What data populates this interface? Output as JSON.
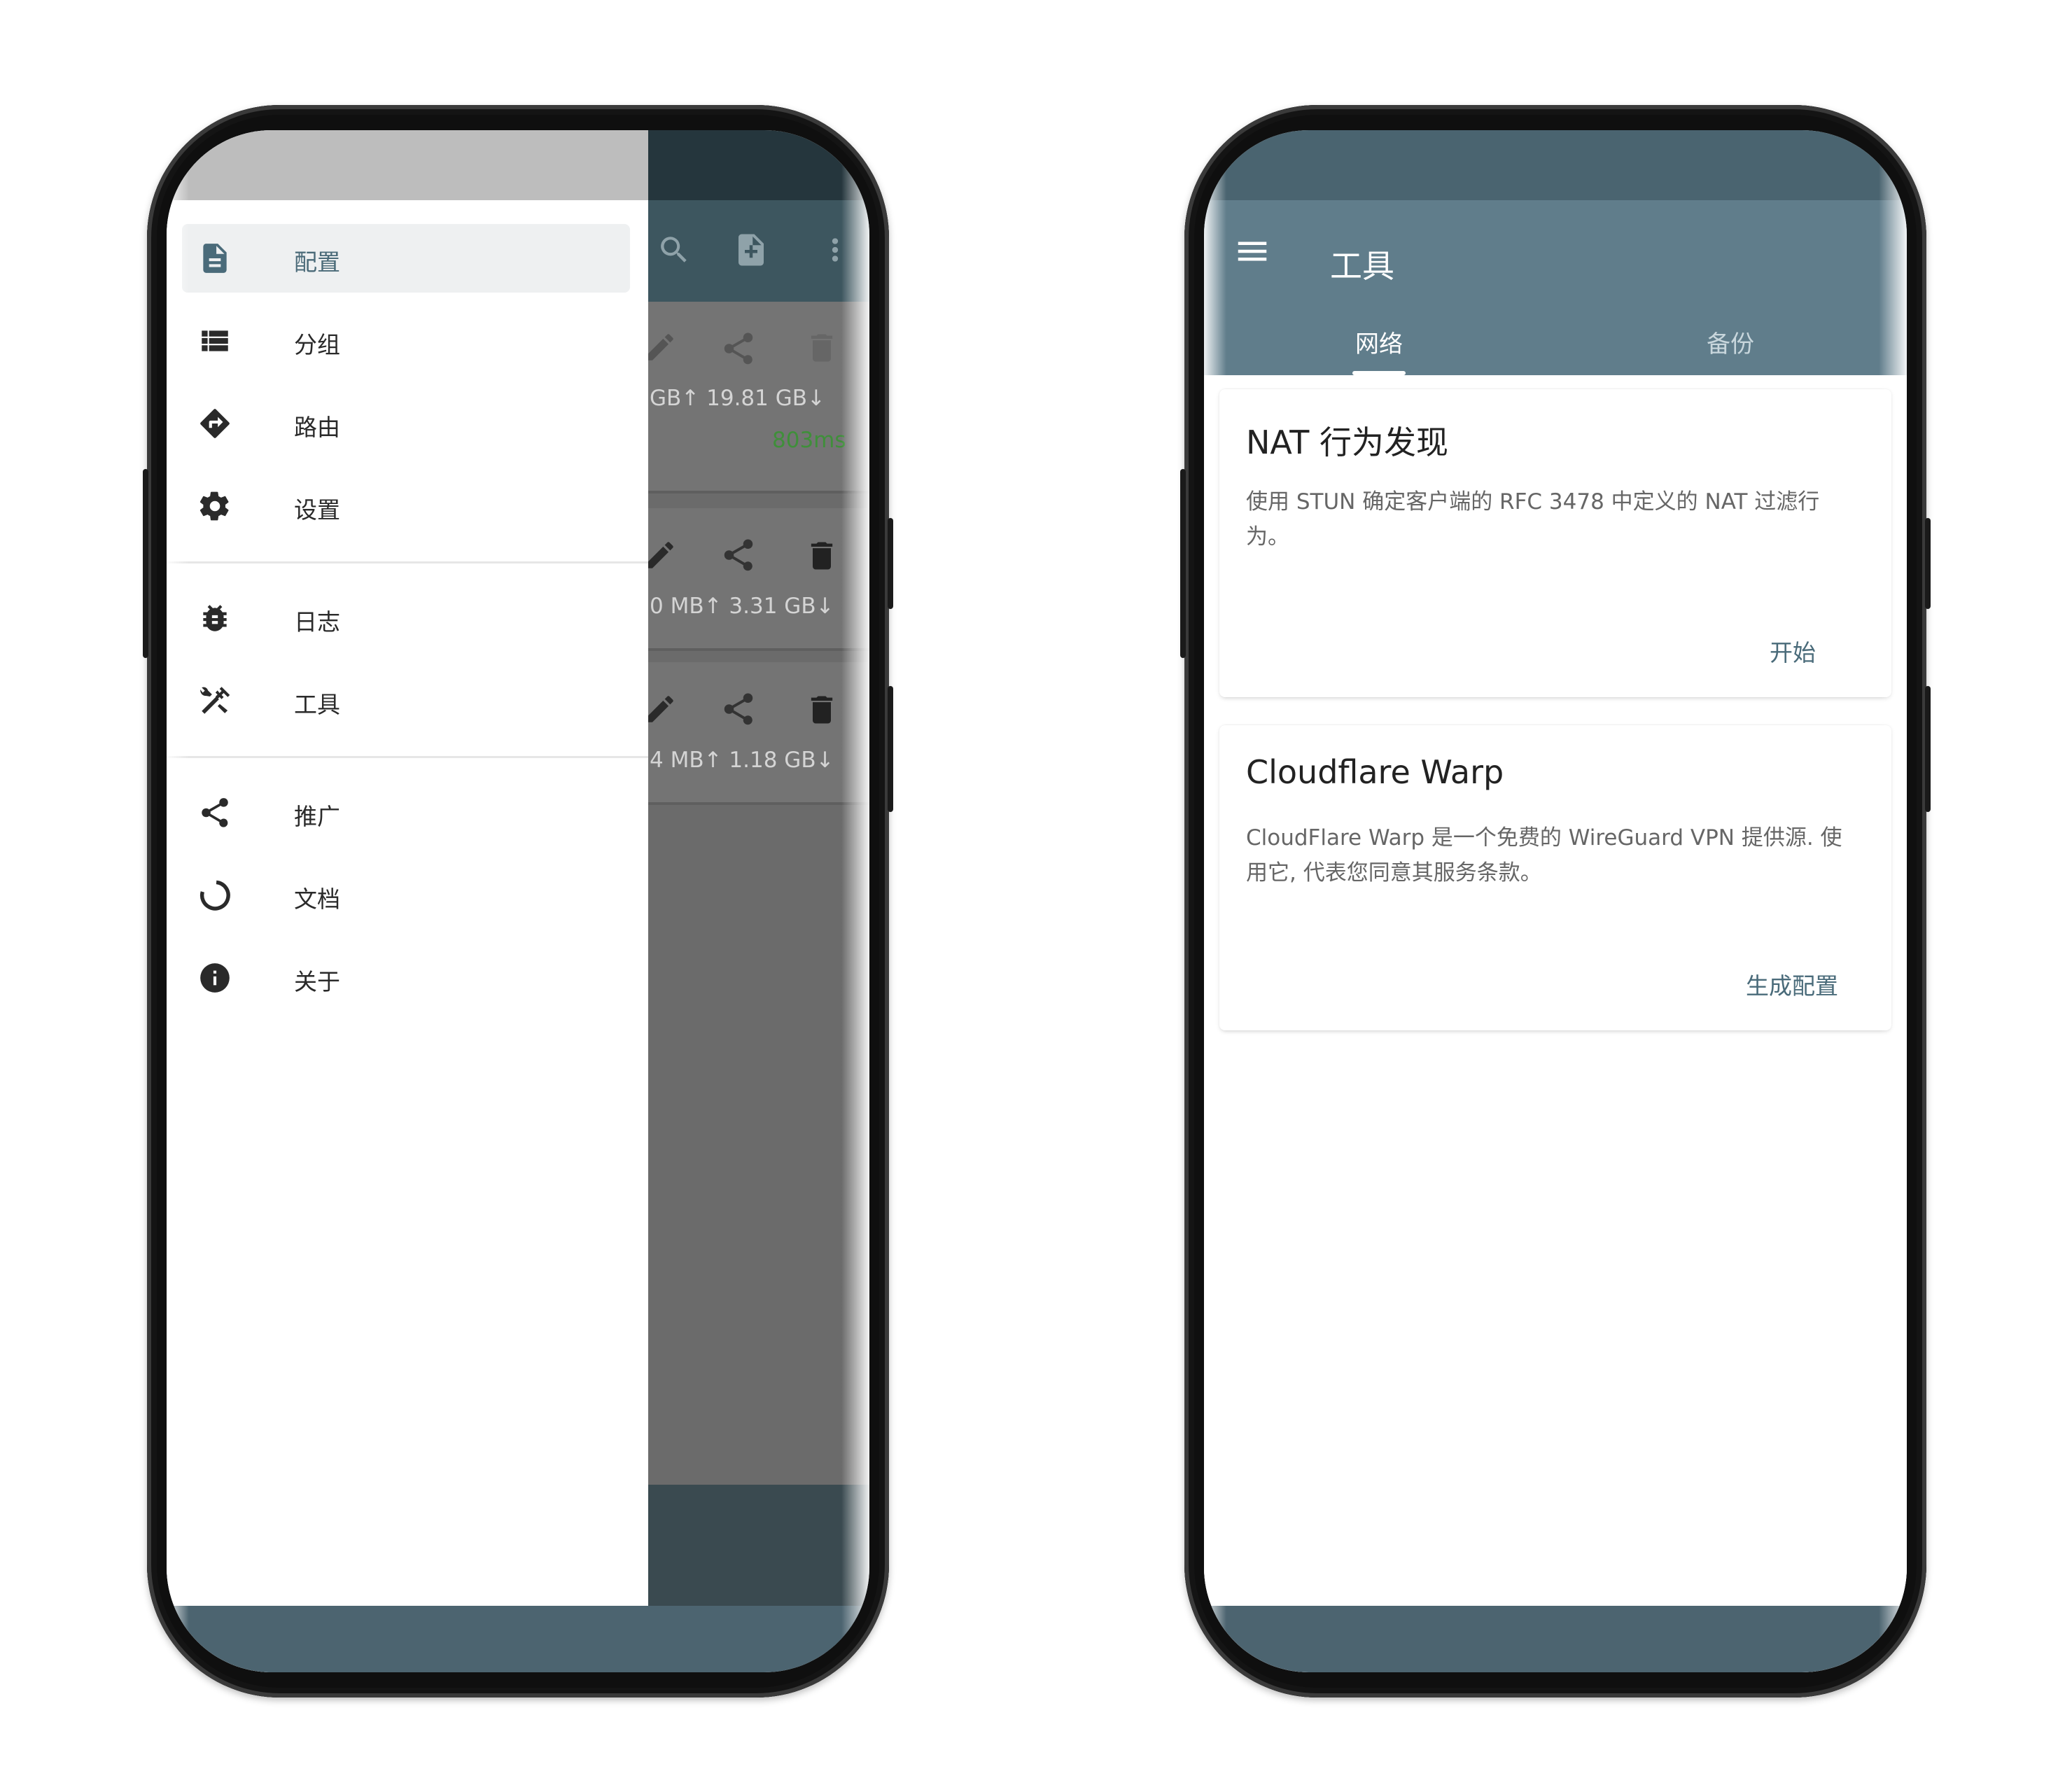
{
  "left_phone": {
    "drawer": {
      "items": [
        {
          "label": "配置",
          "icon": "file-document-icon",
          "active": true
        },
        {
          "label": "分组",
          "icon": "view-list-icon"
        },
        {
          "label": "路由",
          "icon": "directions-icon"
        },
        {
          "label": "设置",
          "icon": "gear-icon"
        },
        {
          "label": "日志",
          "icon": "bug-icon"
        },
        {
          "label": "工具",
          "icon": "tools-icon"
        },
        {
          "label": "推广",
          "icon": "share-icon"
        },
        {
          "label": "文档",
          "icon": "progress-circle-icon"
        },
        {
          "label": "关于",
          "icon": "info-icon"
        }
      ]
    },
    "background_list": {
      "cards": [
        {
          "traffic": "GB↑ 19.81 GB↓",
          "latency": "803ms"
        },
        {
          "traffic": "0 MB↑ 3.31 GB↓"
        },
        {
          "traffic": "4 MB↑ 1.18 GB↓"
        }
      ]
    }
  },
  "right_phone": {
    "title": "工具",
    "tabs": [
      {
        "label": "网络",
        "selected": true
      },
      {
        "label": "备份",
        "selected": false
      }
    ],
    "cards": [
      {
        "title": "NAT 行为发现",
        "description": "使用 STUN 确定客户端的 RFC 3478 中定义的 NAT 过滤行为。",
        "action": "开始"
      },
      {
        "title": "Cloudflare Warp",
        "description": "CloudFlare Warp 是一个免费的 WireGuard VPN 提供源. 使用它, 代表您同意其服务条款。",
        "action": "生成配置"
      }
    ]
  },
  "colors": {
    "primary": "#607d8b",
    "primary_dark": "#4a6470",
    "latency_green": "#3f8f3a",
    "accent_text": "#4a6b7a"
  }
}
